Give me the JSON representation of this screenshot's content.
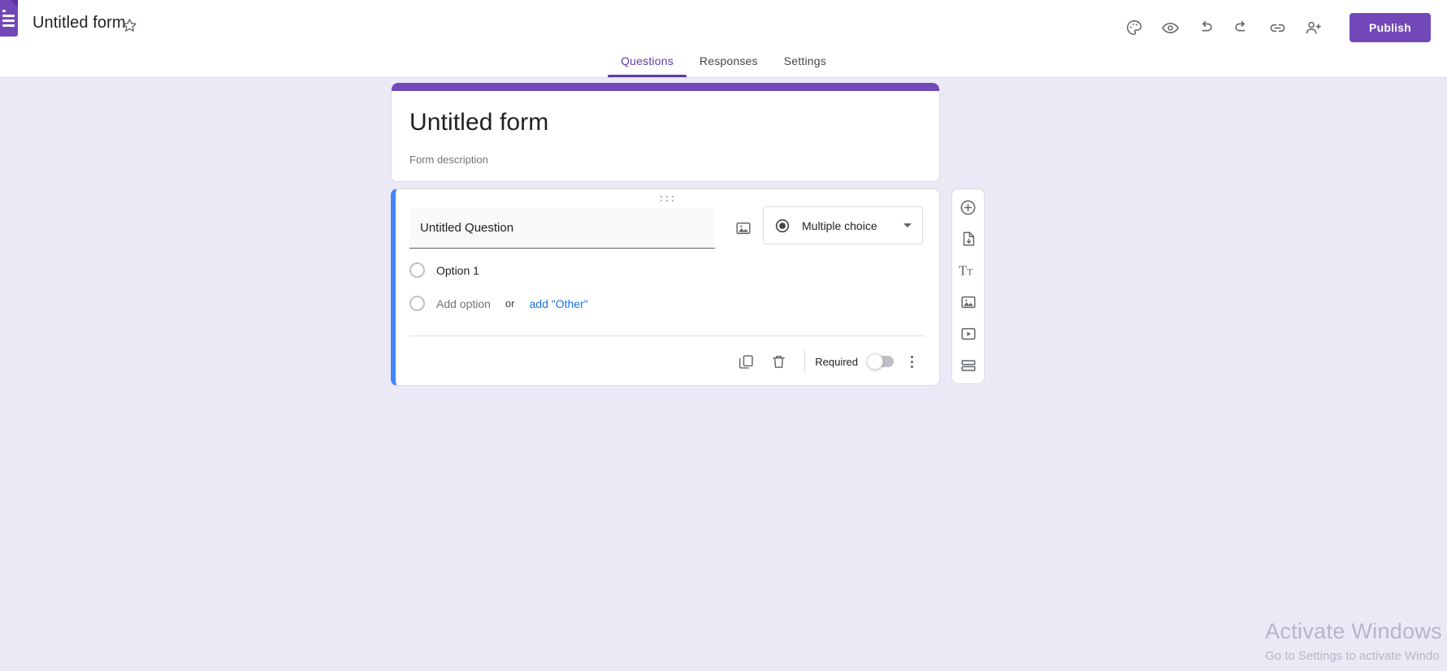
{
  "app": {
    "logo_icon": "google-forms-icon",
    "doc_title": "Untitled form",
    "star_icon": "star-outline-icon"
  },
  "toolbar": {
    "items": [
      {
        "icon": "palette-icon",
        "name": "customize-theme-button"
      },
      {
        "icon": "eye-icon",
        "name": "preview-button"
      },
      {
        "icon": "undo-icon",
        "name": "undo-button"
      },
      {
        "icon": "redo-icon",
        "name": "redo-button"
      },
      {
        "icon": "link-icon",
        "name": "copy-link-button"
      },
      {
        "icon": "person-add-icon",
        "name": "add-collaborator-button"
      }
    ],
    "publish_label": "Publish",
    "publish_color": "#7248b9"
  },
  "tabs": [
    {
      "label": "Questions",
      "active": true
    },
    {
      "label": "Responses",
      "active": false
    },
    {
      "label": "Settings",
      "active": false
    }
  ],
  "form_header": {
    "accent_color": "#7248b9",
    "title": "Untitled form",
    "description": "Form description"
  },
  "question": {
    "selected_accent": "#4285f4",
    "drag_handle_icon": "drag-handle-icon",
    "title": "Untitled Question",
    "image_icon": "image-icon",
    "type_icon": "radio-filled-icon",
    "type_label": "Multiple choice",
    "chevron_icon": "chevron-down-icon",
    "options": [
      {
        "label": "Option 1",
        "placeholder": false
      },
      {
        "label": "Add option",
        "placeholder": true
      }
    ],
    "or_text": "or",
    "add_other_label": "add \"Other\"",
    "add_other_color": "#1a73e8",
    "footer": {
      "duplicate_icon": "duplicate-icon",
      "delete_icon": "trash-icon",
      "required_label": "Required",
      "required_on": false,
      "more_icon": "more-vertical-icon"
    }
  },
  "side_toolbar": [
    {
      "icon": "add-circle-icon",
      "name": "add-question-button"
    },
    {
      "icon": "import-questions-icon",
      "name": "import-questions-button"
    },
    {
      "icon": "title-text-icon",
      "name": "add-title-and-description-button"
    },
    {
      "icon": "image-icon",
      "name": "add-image-button"
    },
    {
      "icon": "video-icon",
      "name": "add-video-button"
    },
    {
      "icon": "section-icon",
      "name": "add-section-button"
    }
  ],
  "watermark": {
    "title": "Activate Windows",
    "subtitle": "Go to Settings to activate Windo"
  }
}
